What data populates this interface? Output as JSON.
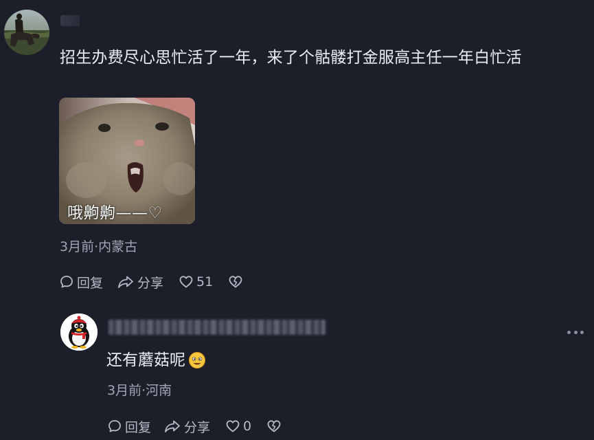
{
  "colors": {
    "background": "#1c1e29",
    "text_primary": "#eceef3",
    "text_meta": "#a2a5b2",
    "icon": "#b7bac6"
  },
  "top_comment": {
    "text": "招生办费尽心思忙活了一年，来了个骷髅打金服高主任一年白忙活",
    "sticker_caption": "哦齁齁——♡",
    "meta": "3月前·内蒙古",
    "actions": {
      "reply_label": "回复",
      "share_label": "分享",
      "like_count": "51"
    },
    "icons": [
      "avatar-image",
      "comment-bubble-icon",
      "share-arrow-icon",
      "heart-icon",
      "broken-heart-icon"
    ]
  },
  "reply": {
    "text": "还有蘑菇呢",
    "meta": "3月前·河南",
    "actions": {
      "reply_label": "回复",
      "share_label": "分享",
      "like_count": "0"
    },
    "icons": [
      "qq-penguin-avatar",
      "more-dots-icon",
      "drooling-face-emoji",
      "comment-bubble-icon",
      "share-arrow-icon",
      "heart-icon",
      "broken-heart-icon"
    ]
  }
}
